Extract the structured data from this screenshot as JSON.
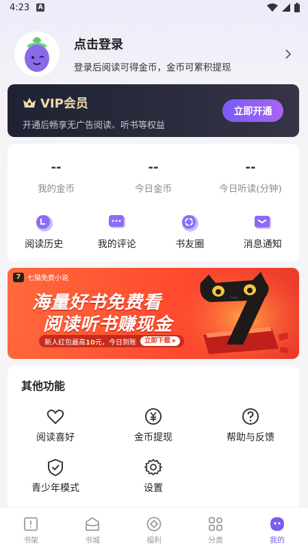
{
  "status_bar": {
    "time": "4:23",
    "notif_letter": "A"
  },
  "profile": {
    "title": "点击登录",
    "subtitle": "登录后阅读可得金币，金币可累积提现"
  },
  "vip": {
    "title": "VIP会员",
    "subtitle": "开通后畅享无广告阅读、听书等权益",
    "button": "立即开通"
  },
  "stats": [
    {
      "value": "--",
      "label": "我的金币"
    },
    {
      "value": "--",
      "label": "今日金币"
    },
    {
      "value": "--",
      "label": "今日听读(分钟)"
    }
  ],
  "quick_actions": [
    {
      "label": "阅读历史",
      "icon": "reading-history-icon"
    },
    {
      "label": "我的评论",
      "icon": "comment-icon"
    },
    {
      "label": "书友圈",
      "icon": "book-circle-icon"
    },
    {
      "label": "消息通知",
      "icon": "notification-icon"
    }
  ],
  "banner": {
    "brand": "七猫免费小说",
    "brand_logo": "7",
    "line1": "海量好书免费看",
    "line2": "阅读听书赚现金",
    "promo_prefix": "新人红包最高",
    "promo_amount": "10",
    "promo_suffix": "元，今日到账",
    "download": "立即下载 ▸"
  },
  "other": {
    "title": "其他功能",
    "items": [
      {
        "label": "阅读喜好",
        "icon": "heart-icon"
      },
      {
        "label": "金币提现",
        "icon": "yen-icon"
      },
      {
        "label": "帮助与反馈",
        "icon": "help-icon"
      },
      {
        "label": "青少年模式",
        "icon": "shield-icon"
      },
      {
        "label": "设置",
        "icon": "gear-icon"
      }
    ]
  },
  "tabs": [
    {
      "label": "书架",
      "icon": "bookshelf-icon",
      "active": false
    },
    {
      "label": "书城",
      "icon": "bookstore-icon",
      "active": false
    },
    {
      "label": "福利",
      "icon": "welfare-icon",
      "active": false
    },
    {
      "label": "分类",
      "icon": "category-icon",
      "active": false
    },
    {
      "label": "我的",
      "icon": "profile-icon",
      "active": true
    }
  ],
  "colors": {
    "accent": "#7c5cf0",
    "vip_gold": "#f1d9a7",
    "banner_red": "#ff4b2f"
  }
}
